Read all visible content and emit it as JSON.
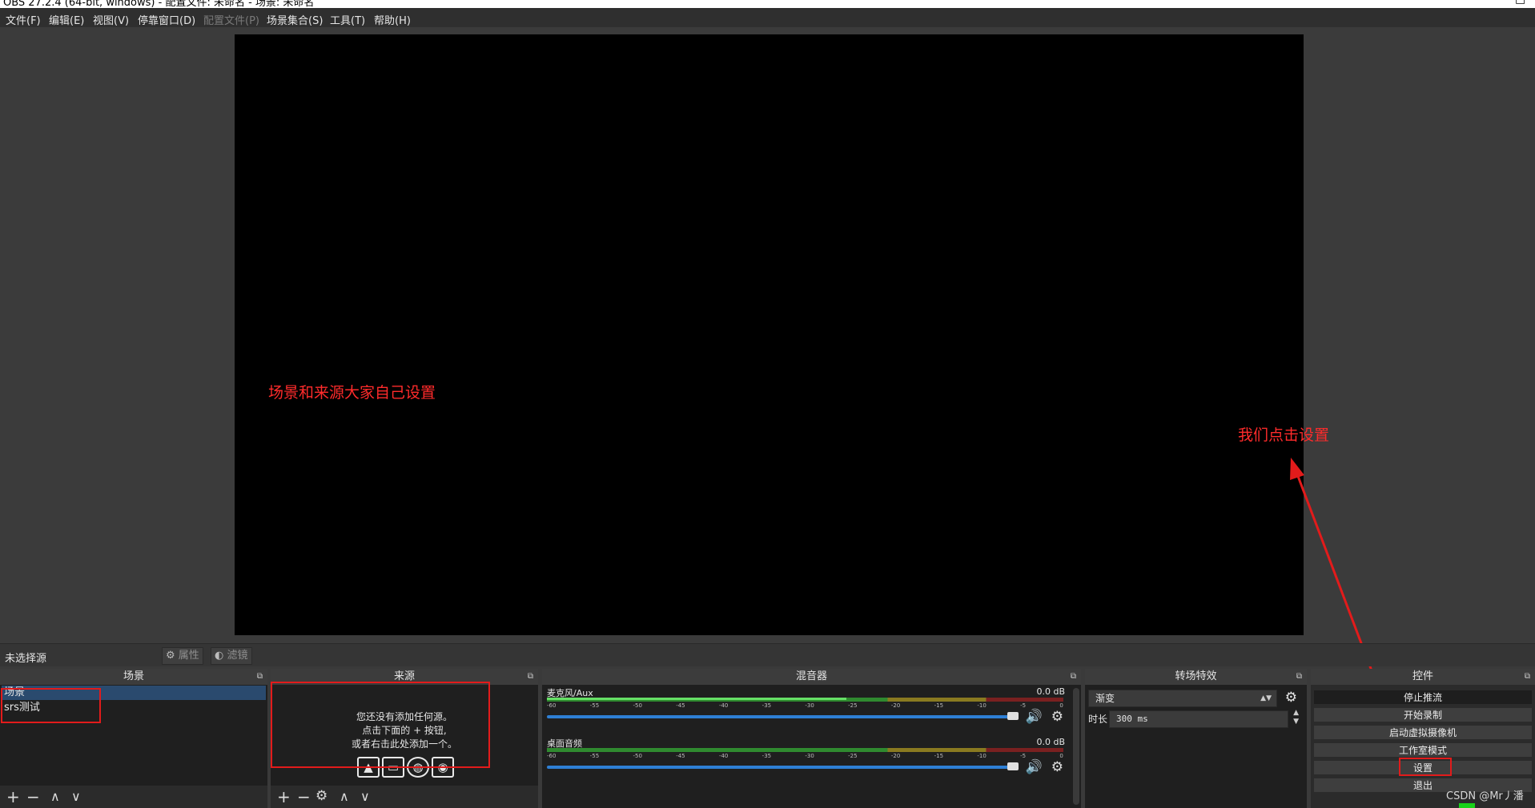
{
  "window": {
    "title": "OBS 27.2.4 (64-bit, windows) - 配置文件: 未命名 - 场景: 未命名",
    "controls": [
      "—",
      "□"
    ]
  },
  "menu": [
    {
      "label": "文件(F)",
      "disabled": false
    },
    {
      "label": "编辑(E)",
      "disabled": false
    },
    {
      "label": "视图(V)",
      "disabled": false
    },
    {
      "label": "停靠窗口(D)",
      "disabled": false
    },
    {
      "label": "配置文件(P)",
      "disabled": true
    },
    {
      "label": "场景集合(S)",
      "disabled": false
    },
    {
      "label": "工具(T)",
      "disabled": false
    },
    {
      "label": "帮助(H)",
      "disabled": false
    }
  ],
  "annotations": {
    "scene_note": "场景和来源大家自己设置",
    "settings_note": "我们点击设置",
    "arrow_color": "#e21b1b"
  },
  "source_toolbar": {
    "no_source_label": "未选择源",
    "properties_label": "属性",
    "filters_label": "滤镜"
  },
  "docks": {
    "scenes": {
      "title": "场景",
      "items": [
        {
          "label": "场景",
          "selected": true
        },
        {
          "label": "srs测试",
          "selected": false
        }
      ],
      "toolbar": [
        "+",
        "−",
        "∧",
        "∨"
      ]
    },
    "sources": {
      "title": "来源",
      "empty_lines": [
        "您还没有添加任何源。",
        "点击下面的 + 按钮,",
        "或者右击此处添加一个。"
      ],
      "source_type_icons": [
        "image-source-icon",
        "display-capture-icon",
        "browser-source-icon",
        "camera-source-icon"
      ],
      "toolbar": [
        "+",
        "−",
        "⚙",
        "∧",
        "∨"
      ]
    },
    "mixer": {
      "title": "混音器",
      "channels": [
        {
          "name": "麦克风/Aux",
          "db": "0.0 dB",
          "volume": 1.0
        },
        {
          "name": "桌面音频",
          "db": "0.0 dB",
          "volume": 1.0
        }
      ],
      "scale": [
        "-60",
        "-55",
        "-50",
        "-45",
        "-40",
        "-35",
        "-30",
        "-25",
        "-20",
        "-15",
        "-10",
        "-5",
        "0"
      ]
    },
    "transitions": {
      "title": "转场特效",
      "selected": "渐变",
      "duration_label": "时长",
      "duration_value": "300 ms"
    },
    "controls": {
      "title": "控件",
      "buttons": [
        "停止推流",
        "开始录制",
        "启动虚拟摄像机",
        "工作室模式",
        "设置",
        "退出"
      ]
    }
  },
  "watermark": "CSDN @Mr丿潘",
  "colors": {
    "highlight": "#e21b1b",
    "meter_green": "#66e066",
    "slider_blue": "#2e7fd4",
    "status_green": "#19d319"
  }
}
